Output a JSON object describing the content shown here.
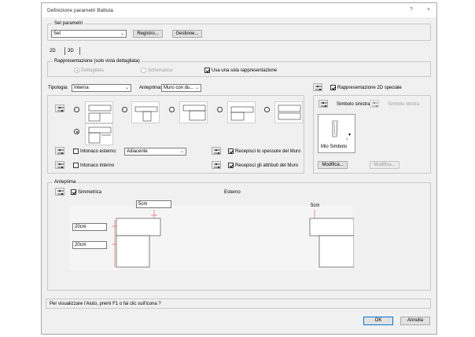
{
  "window": {
    "title": "Definizione parametri Battuta",
    "help_btn": "?",
    "close_btn": "×"
  },
  "set_params": {
    "label": "Set parametri",
    "select_value": "Set",
    "registro_btn": "Registro...",
    "gestione_btn": "Gestione..."
  },
  "tabs": [
    "2D",
    "3D"
  ],
  "rappresentazione": {
    "label": "Rappresentazione (solo vista dettagliata)",
    "dettagliata": "Dettagliata",
    "schematica": "Schematica",
    "usa_una": "Usa una sola rappresentazione"
  },
  "tipologia": {
    "label": "Tipologia:",
    "value": "Interna"
  },
  "anteprima_sel": {
    "label": "Anteprima:",
    "value": "Muro con du..."
  },
  "rapp2d": {
    "label": "Rappresentazione 2D speciale",
    "simbolo_sinistra": "Simbolo sinistra",
    "simbolo_destra": "Simbolo destra",
    "mio_simbolo": "Mio Simbolo",
    "modifica_1": "Modifica...",
    "modifica_2": "Modifica..."
  },
  "intonaco": {
    "esterno_label": "Intonaco esterno:",
    "esterno_value": "Adiacente",
    "interno_label": "Intonaco interno",
    "recepisci_spessore": "Recepisci lo spessore del Muro",
    "recepisci_attributi": "Recepisci gli attributi del Muro"
  },
  "anteprima": {
    "label": "Anteprima",
    "simmetrica": "Simmetrica",
    "esterno": "Esterno",
    "dim_5cm_left": "5cm",
    "dim_5cm_right": "5cm",
    "dim_20cm_1": "20cm",
    "dim_20cm_2": "20cm"
  },
  "status_text": "Per visualizzare l'Aiuto, premi F1 o fai clic sull'icona ?",
  "footer": {
    "ok": "OK",
    "annulla": "Annulla"
  }
}
